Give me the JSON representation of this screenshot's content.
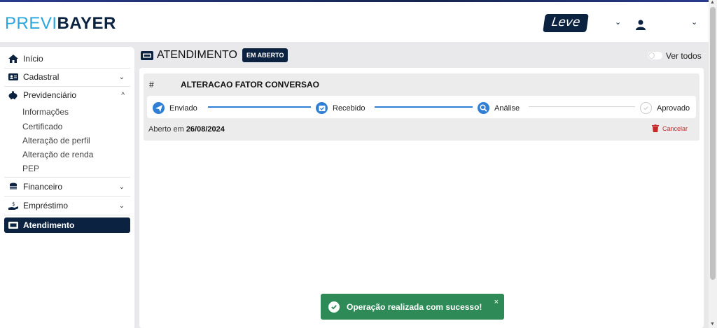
{
  "header": {
    "logo_part1": "PREVI",
    "logo_part2": "BAYER",
    "leve_logo": "Leve",
    "chevron": "⌄",
    "user_icon": "user-icon"
  },
  "sidebar": {
    "items": [
      {
        "label": "Início",
        "icon": "home-icon"
      },
      {
        "label": "Cadastral",
        "icon": "id-card-icon"
      },
      {
        "label": "Previdenciário",
        "icon": "piggy-bank-icon"
      },
      {
        "label": "Financeiro",
        "icon": "coins-icon"
      },
      {
        "label": "Empréstimo",
        "icon": "hand-money-icon"
      },
      {
        "label": "Atendimento",
        "icon": "ticket-icon"
      }
    ],
    "sub_items": [
      "Informações",
      "Certificado",
      "Alteração de perfil",
      "Alteração de renda",
      "PEP"
    ]
  },
  "main": {
    "title": "ATENDIMENTO",
    "badge": "EM ABERTO",
    "toggle_label": "Ver todos",
    "card": {
      "hash": "#",
      "title": "ALTERACAO FATOR CONVERSAO",
      "steps": [
        "Enviado",
        "Recebido",
        "Análise",
        "Aprovado"
      ],
      "opened_prefix": "Aberto em",
      "opened_date": "26/08/2024",
      "cancel_label": "Cancelar"
    }
  },
  "toast": {
    "message": "Operação realizada com sucesso!",
    "close": "×"
  },
  "colors": {
    "navy": "#0b2341",
    "accent_blue": "#2aa6df",
    "step_blue": "#2f7fd4",
    "toast_green": "#2e8b57",
    "cancel_red": "#c62828"
  }
}
